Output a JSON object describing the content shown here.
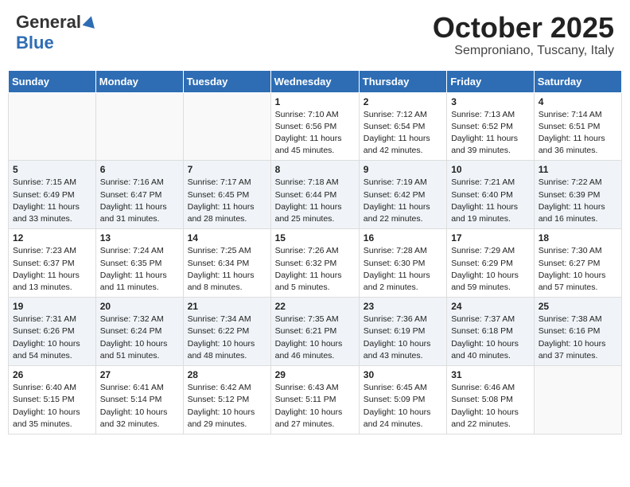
{
  "header": {
    "logo_general": "General",
    "logo_blue": "Blue",
    "month_title": "October 2025",
    "location": "Semproniano, Tuscany, Italy"
  },
  "days_of_week": [
    "Sunday",
    "Monday",
    "Tuesday",
    "Wednesday",
    "Thursday",
    "Friday",
    "Saturday"
  ],
  "weeks": [
    [
      {
        "day": "",
        "info": ""
      },
      {
        "day": "",
        "info": ""
      },
      {
        "day": "",
        "info": ""
      },
      {
        "day": "1",
        "info": "Sunrise: 7:10 AM\nSunset: 6:56 PM\nDaylight: 11 hours and 45 minutes."
      },
      {
        "day": "2",
        "info": "Sunrise: 7:12 AM\nSunset: 6:54 PM\nDaylight: 11 hours and 42 minutes."
      },
      {
        "day": "3",
        "info": "Sunrise: 7:13 AM\nSunset: 6:52 PM\nDaylight: 11 hours and 39 minutes."
      },
      {
        "day": "4",
        "info": "Sunrise: 7:14 AM\nSunset: 6:51 PM\nDaylight: 11 hours and 36 minutes."
      }
    ],
    [
      {
        "day": "5",
        "info": "Sunrise: 7:15 AM\nSunset: 6:49 PM\nDaylight: 11 hours and 33 minutes."
      },
      {
        "day": "6",
        "info": "Sunrise: 7:16 AM\nSunset: 6:47 PM\nDaylight: 11 hours and 31 minutes."
      },
      {
        "day": "7",
        "info": "Sunrise: 7:17 AM\nSunset: 6:45 PM\nDaylight: 11 hours and 28 minutes."
      },
      {
        "day": "8",
        "info": "Sunrise: 7:18 AM\nSunset: 6:44 PM\nDaylight: 11 hours and 25 minutes."
      },
      {
        "day": "9",
        "info": "Sunrise: 7:19 AM\nSunset: 6:42 PM\nDaylight: 11 hours and 22 minutes."
      },
      {
        "day": "10",
        "info": "Sunrise: 7:21 AM\nSunset: 6:40 PM\nDaylight: 11 hours and 19 minutes."
      },
      {
        "day": "11",
        "info": "Sunrise: 7:22 AM\nSunset: 6:39 PM\nDaylight: 11 hours and 16 minutes."
      }
    ],
    [
      {
        "day": "12",
        "info": "Sunrise: 7:23 AM\nSunset: 6:37 PM\nDaylight: 11 hours and 13 minutes."
      },
      {
        "day": "13",
        "info": "Sunrise: 7:24 AM\nSunset: 6:35 PM\nDaylight: 11 hours and 11 minutes."
      },
      {
        "day": "14",
        "info": "Sunrise: 7:25 AM\nSunset: 6:34 PM\nDaylight: 11 hours and 8 minutes."
      },
      {
        "day": "15",
        "info": "Sunrise: 7:26 AM\nSunset: 6:32 PM\nDaylight: 11 hours and 5 minutes."
      },
      {
        "day": "16",
        "info": "Sunrise: 7:28 AM\nSunset: 6:30 PM\nDaylight: 11 hours and 2 minutes."
      },
      {
        "day": "17",
        "info": "Sunrise: 7:29 AM\nSunset: 6:29 PM\nDaylight: 10 hours and 59 minutes."
      },
      {
        "day": "18",
        "info": "Sunrise: 7:30 AM\nSunset: 6:27 PM\nDaylight: 10 hours and 57 minutes."
      }
    ],
    [
      {
        "day": "19",
        "info": "Sunrise: 7:31 AM\nSunset: 6:26 PM\nDaylight: 10 hours and 54 minutes."
      },
      {
        "day": "20",
        "info": "Sunrise: 7:32 AM\nSunset: 6:24 PM\nDaylight: 10 hours and 51 minutes."
      },
      {
        "day": "21",
        "info": "Sunrise: 7:34 AM\nSunset: 6:22 PM\nDaylight: 10 hours and 48 minutes."
      },
      {
        "day": "22",
        "info": "Sunrise: 7:35 AM\nSunset: 6:21 PM\nDaylight: 10 hours and 46 minutes."
      },
      {
        "day": "23",
        "info": "Sunrise: 7:36 AM\nSunset: 6:19 PM\nDaylight: 10 hours and 43 minutes."
      },
      {
        "day": "24",
        "info": "Sunrise: 7:37 AM\nSunset: 6:18 PM\nDaylight: 10 hours and 40 minutes."
      },
      {
        "day": "25",
        "info": "Sunrise: 7:38 AM\nSunset: 6:16 PM\nDaylight: 10 hours and 37 minutes."
      }
    ],
    [
      {
        "day": "26",
        "info": "Sunrise: 6:40 AM\nSunset: 5:15 PM\nDaylight: 10 hours and 35 minutes."
      },
      {
        "day": "27",
        "info": "Sunrise: 6:41 AM\nSunset: 5:14 PM\nDaylight: 10 hours and 32 minutes."
      },
      {
        "day": "28",
        "info": "Sunrise: 6:42 AM\nSunset: 5:12 PM\nDaylight: 10 hours and 29 minutes."
      },
      {
        "day": "29",
        "info": "Sunrise: 6:43 AM\nSunset: 5:11 PM\nDaylight: 10 hours and 27 minutes."
      },
      {
        "day": "30",
        "info": "Sunrise: 6:45 AM\nSunset: 5:09 PM\nDaylight: 10 hours and 24 minutes."
      },
      {
        "day": "31",
        "info": "Sunrise: 6:46 AM\nSunset: 5:08 PM\nDaylight: 10 hours and 22 minutes."
      },
      {
        "day": "",
        "info": ""
      }
    ]
  ]
}
